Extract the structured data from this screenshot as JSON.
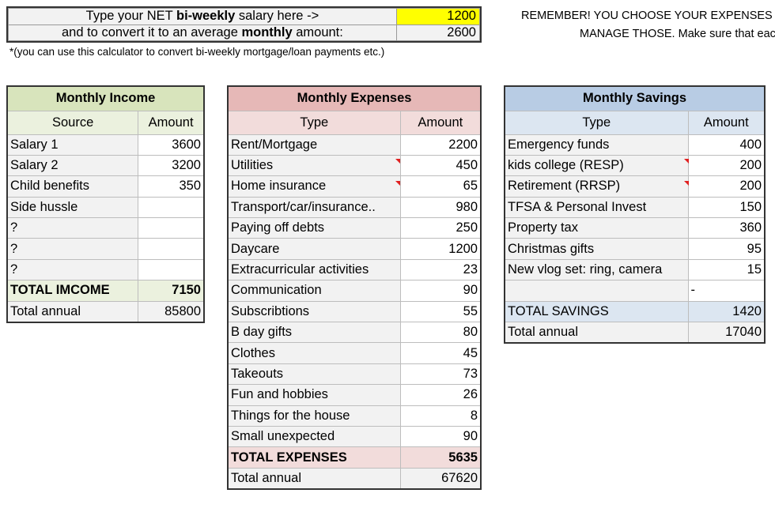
{
  "converter": {
    "row1_pre": "Type your NET ",
    "row1_bold": "bi-weekly",
    "row1_post": " salary here  ->",
    "row1_value": "1200",
    "row2_pre": "and to convert it to an average ",
    "row2_bold": "monthly",
    "row2_post": " amount:",
    "row2_value": "2600",
    "highlight_color": "#ffff00"
  },
  "note": "*(you can use this calculator to convert bi-weekly mortgage/loan payments etc.)",
  "reminder": {
    "line1": "REMEMBER! YOU CHOOSE YOUR EXPENSES AN",
    "line2": "MANAGE THOSE. Make sure that eac"
  },
  "income": {
    "title": "Monthly Income",
    "col_source": "Source",
    "col_amount": "Amount",
    "rows": [
      {
        "label": "Salary 1",
        "amount": "3600"
      },
      {
        "label": "Salary 2",
        "amount": "3200"
      },
      {
        "label": "Child benefits",
        "amount": "350"
      },
      {
        "label": "Side hussle",
        "amount": ""
      },
      {
        "label": "?",
        "amount": ""
      },
      {
        "label": "?",
        "amount": ""
      },
      {
        "label": "?",
        "amount": ""
      }
    ],
    "total_label": "TOTAL IMCOME",
    "total_value": "7150",
    "annual_label": "Total annual",
    "annual_value": "85800"
  },
  "expenses": {
    "title": "Monthly Expenses",
    "col_type": "Type",
    "col_amount": "Amount",
    "rows": [
      {
        "label": "Rent/Mortgage",
        "amount": "2200"
      },
      {
        "label": "Utilities",
        "amount": "450"
      },
      {
        "label": "Home insurance",
        "amount": "65"
      },
      {
        "label": "Transport/car/insurance..",
        "amount": "980"
      },
      {
        "label": "Paying off debts",
        "amount": "250"
      },
      {
        "label": "Daycare",
        "amount": "1200"
      },
      {
        "label": "Extracurricular activities",
        "amount": "23"
      },
      {
        "label": "Communication",
        "amount": "90"
      },
      {
        "label": "Subscribtions",
        "amount": "55"
      },
      {
        "label": "B day gifts",
        "amount": "80"
      },
      {
        "label": "Clothes",
        "amount": "45"
      },
      {
        "label": "Takeouts",
        "amount": "73"
      },
      {
        "label": "Fun and hobbies",
        "amount": "26"
      },
      {
        "label": "Things for the house",
        "amount": "8"
      },
      {
        "label": "Small unexpected",
        "amount": "90"
      }
    ],
    "total_label": "TOTAL EXPENSES",
    "total_value": "5635",
    "annual_label": "Total annual",
    "annual_value": "67620"
  },
  "savings": {
    "title": "Monthly Savings",
    "col_type": "Type",
    "col_amount": "Amount",
    "rows": [
      {
        "label": "Emergency funds",
        "amount": "400"
      },
      {
        "label": "kids college (RESP)",
        "amount": "200"
      },
      {
        "label": "Retirement (RRSP)",
        "amount": "200"
      },
      {
        "label": "TFSA & Personal Invest",
        "amount": "150"
      },
      {
        "label": "Property tax",
        "amount": "360"
      },
      {
        "label": "Christmas gifts",
        "amount": "95"
      },
      {
        "label": "New vlog set: ring, camera",
        "amount": "15"
      },
      {
        "label": "",
        "amount": "-"
      }
    ],
    "total_label": "TOTAL SAVINGS",
    "total_value": "1420",
    "annual_label": "Total annual",
    "annual_value": "17040"
  }
}
